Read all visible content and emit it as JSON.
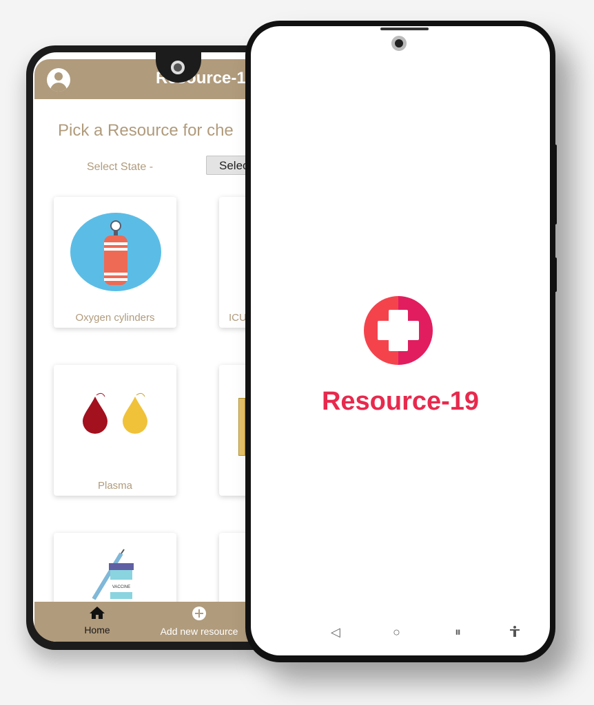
{
  "back_app": {
    "title": "Resource-19",
    "pick_text": "Pick a Resource for che",
    "state_label": "Select State -",
    "select_label": "Select",
    "cards": [
      {
        "label": "Oxygen cylinders"
      },
      {
        "label": "ICU"
      },
      {
        "label": "Plasma"
      },
      {
        "label": ""
      },
      {
        "label": ""
      },
      {
        "label": ""
      }
    ],
    "nav": {
      "home": "Home",
      "add": "Add new resource"
    },
    "vaccine_text": "VACCINE"
  },
  "splash": {
    "brand": "Resource-19"
  },
  "colors": {
    "header": "#b09b7c",
    "brand": "#e8294d",
    "logo_left": "#f5434c",
    "logo_right": "#e11d60"
  }
}
